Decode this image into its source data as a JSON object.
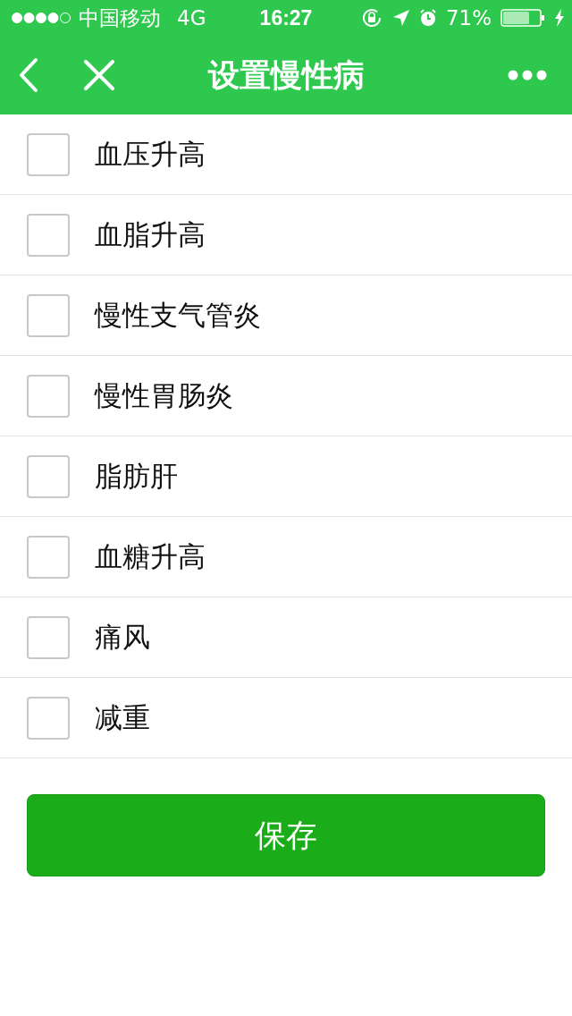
{
  "status_bar": {
    "carrier": "中国移动",
    "network": "4G",
    "time": "16:27",
    "battery": "71%"
  },
  "nav": {
    "title": "设置慢性病"
  },
  "items": [
    {
      "label": "血压升高",
      "checked": false
    },
    {
      "label": "血脂升高",
      "checked": false
    },
    {
      "label": "慢性支气管炎",
      "checked": false
    },
    {
      "label": "慢性胃肠炎",
      "checked": false
    },
    {
      "label": "脂肪肝",
      "checked": false
    },
    {
      "label": "血糖升高",
      "checked": false
    },
    {
      "label": "痛风",
      "checked": false
    },
    {
      "label": "减重",
      "checked": false
    }
  ],
  "save_button": {
    "label": "保存"
  }
}
